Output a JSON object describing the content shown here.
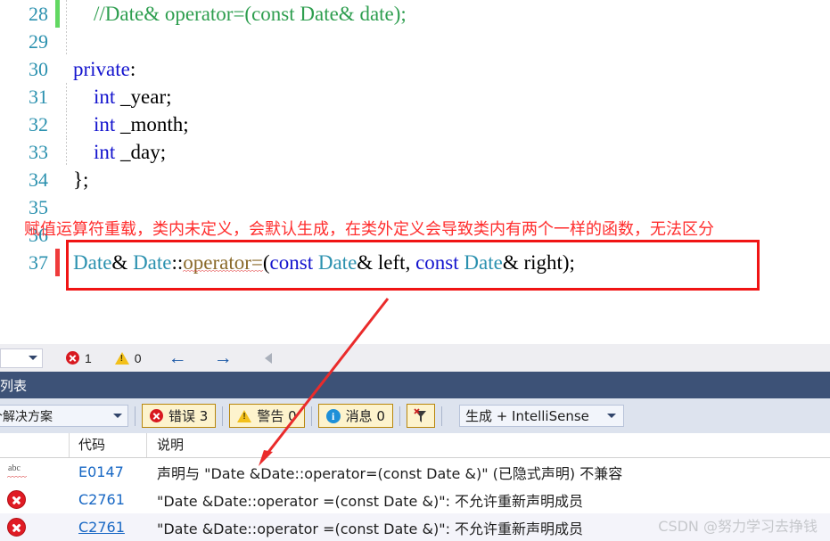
{
  "editor": {
    "lines": [
      {
        "num": "28",
        "changebar": "green",
        "indent": true,
        "highlight": false,
        "tokens": [
          {
            "t": "    //Date& operator=(const Date& date);",
            "c": "tk-comment"
          }
        ]
      },
      {
        "num": "29",
        "changebar": "none",
        "indent": true,
        "highlight": false,
        "tokens": [
          {
            "t": "",
            "c": "tk-plain"
          }
        ]
      },
      {
        "num": "30",
        "changebar": "none",
        "indent": false,
        "highlight": true,
        "tokens": [
          {
            "t": "private",
            "c": "tk-keyword"
          },
          {
            "t": ":",
            "c": "tk-plain"
          }
        ]
      },
      {
        "num": "31",
        "changebar": "none",
        "indent": true,
        "highlight": false,
        "tokens": [
          {
            "t": "    ",
            "c": "tk-plain"
          },
          {
            "t": "int",
            "c": "tk-keyword"
          },
          {
            "t": " _year;",
            "c": "tk-plain"
          }
        ]
      },
      {
        "num": "32",
        "changebar": "none",
        "indent": true,
        "highlight": false,
        "tokens": [
          {
            "t": "    ",
            "c": "tk-plain"
          },
          {
            "t": "int",
            "c": "tk-keyword"
          },
          {
            "t": " _month;",
            "c": "tk-plain"
          }
        ]
      },
      {
        "num": "33",
        "changebar": "none",
        "indent": true,
        "highlight": false,
        "tokens": [
          {
            "t": "    ",
            "c": "tk-plain"
          },
          {
            "t": "int",
            "c": "tk-keyword"
          },
          {
            "t": " _day;",
            "c": "tk-plain"
          }
        ]
      },
      {
        "num": "34",
        "changebar": "none",
        "indent": false,
        "highlight": false,
        "tokens": [
          {
            "t": "};",
            "c": "tk-plain"
          }
        ]
      },
      {
        "num": "35",
        "changebar": "none",
        "indent": false,
        "highlight": false,
        "tokens": [
          {
            "t": "",
            "c": "tk-plain"
          }
        ]
      },
      {
        "num": "36",
        "changebar": "none",
        "indent": false,
        "highlight": false,
        "tokens": [
          {
            "t": "",
            "c": "tk-plain"
          }
        ]
      },
      {
        "num": "37",
        "changebar": "red",
        "indent": false,
        "highlight": false,
        "tokens": [
          {
            "t": "Date",
            "c": "tk-type"
          },
          {
            "t": "& ",
            "c": "tk-plain"
          },
          {
            "t": "Date",
            "c": "tk-type"
          },
          {
            "t": "::",
            "c": "tk-plain"
          },
          {
            "t": "operator=",
            "c": "tk-func"
          },
          {
            "t": "(",
            "c": "tk-plain"
          },
          {
            "t": "const",
            "c": "tk-keyword"
          },
          {
            "t": " ",
            "c": "tk-plain"
          },
          {
            "t": "Date",
            "c": "tk-type"
          },
          {
            "t": "& left, ",
            "c": "tk-plain"
          },
          {
            "t": "const",
            "c": "tk-keyword"
          },
          {
            "t": " ",
            "c": "tk-plain"
          },
          {
            "t": "Date",
            "c": "tk-type"
          },
          {
            "t": "& right);",
            "c": "tk-plain"
          }
        ]
      }
    ]
  },
  "annotation": {
    "note_text": "赋值运算符重载，类内未定义，会默认生成，在类外定义会导致类内有两个一样的函数，无法区分",
    "note_color": "#ff2d2d",
    "box_color": "#f01414",
    "arrow_color": "#ea2b2b"
  },
  "navstrip": {
    "error_count": "1",
    "warning_count": "0",
    "back_arrow": "←",
    "forward_arrow": "→"
  },
  "toolwindow": {
    "title": "列表",
    "scope_value": "个解决方案",
    "filters": [
      {
        "name": "errors",
        "label": "错误 3",
        "icon": "error-icon"
      },
      {
        "name": "warnings",
        "label": "警告 0",
        "icon": "warning-icon"
      },
      {
        "name": "messages",
        "label": "消息 0",
        "icon": "info-icon"
      }
    ],
    "clear_filter_icon": "clear-filter-icon",
    "build_scope": "生成 + IntelliSense"
  },
  "grid": {
    "headers": {
      "icon": "",
      "code": "代码",
      "description": "说明"
    },
    "rows": [
      {
        "icon": "intellisense-squiggle-icon",
        "code": "E0147",
        "code_link": false,
        "description": "声明与 \"Date &Date::operator=(const Date &)\" (已隐式声明) 不兼容",
        "alt": false
      },
      {
        "icon": "error-icon",
        "code": "C2761",
        "code_link": false,
        "description": "\"Date &Date::operator =(const Date &)\": 不允许重新声明成员",
        "alt": false
      },
      {
        "icon": "error-icon",
        "code": "C2761",
        "code_link": true,
        "description": "\"Date &Date::operator =(const Date &)\": 不允许重新声明成员",
        "alt": true
      }
    ]
  },
  "watermark": {
    "text": "CSDN @努力学习去挣钱"
  }
}
